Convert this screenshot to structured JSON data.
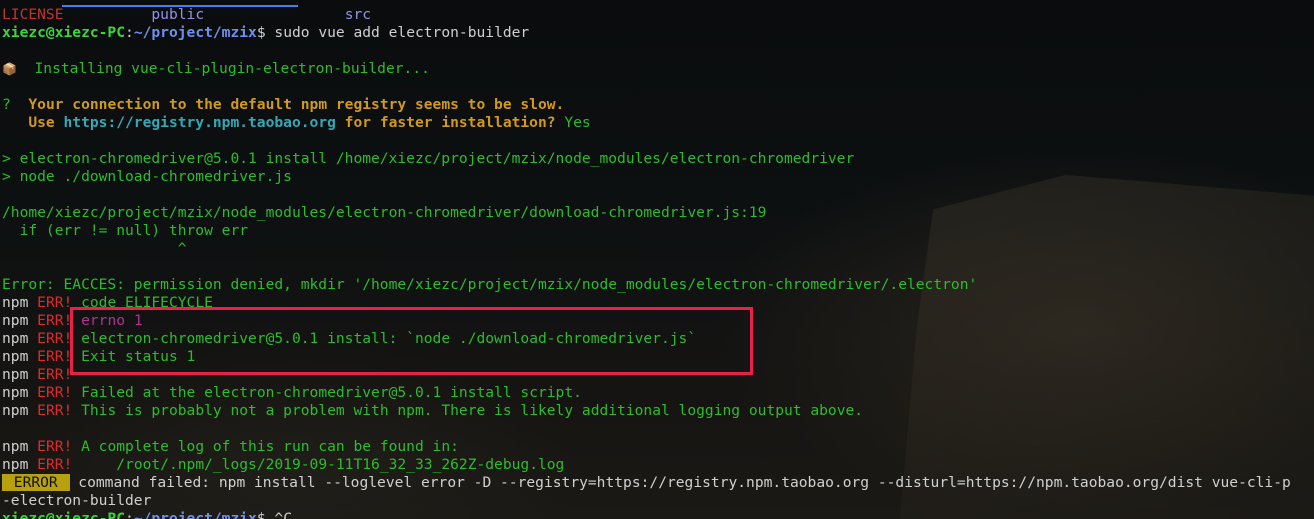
{
  "listing": {
    "license": "LICENSE",
    "public": "public",
    "src": "src"
  },
  "prompt": {
    "user_host": "xiezc@xiezc-PC",
    "colon": ":",
    "path": "~/project/mzix",
    "dollar": "$",
    "command": " sudo vue add electron-builder",
    "final_input": " ^C"
  },
  "installing": {
    "icon": "📦",
    "text": "  Installing vue-cli-plugin-electron-builder..."
  },
  "question": {
    "mark": "?",
    "line1": "  Your connection to the default npm registry seems to be slow.",
    "line2_pre": "   Use ",
    "url": "https://registry.npm.taobao.org",
    "line2_post": " for faster installation?",
    "answer": " Yes"
  },
  "install_lines": [
    "> electron-chromedriver@5.0.1 install /home/xiezc/project/mzix/node_modules/electron-chromedriver",
    "> node ./download-chromedriver.js"
  ],
  "trace": {
    "file": "/home/xiezc/project/mzix/node_modules/electron-chromedriver/download-chromedriver.js:19",
    "code": "  if (err != null) throw err",
    "caret": "                    ^"
  },
  "error_line": "Error: EACCES: permission denied, mkdir '/home/xiezc/project/mzix/node_modules/electron-chromedriver/.electron'",
  "npm_err": {
    "npm": "npm",
    "err": "ERR!",
    "lines": [
      " code ELIFECYCLE",
      " errno 1",
      " electron-chromedriver@5.0.1 install: `node ./download-chromedriver.js`",
      " Exit status 1",
      "",
      " Failed at the electron-chromedriver@5.0.1 install script.",
      " This is probably not a problem with npm. There is likely additional logging output above.",
      " A complete log of this run can be found in:",
      "     /root/.npm/_logs/2019-09-11T16_32_33_262Z-debug.log"
    ]
  },
  "error_badge": " ERROR ",
  "command_failed": " command failed: npm install --loglevel error -D --registry=https://registry.npm.taobao.org --disturl=https://npm.taobao.org/dist vue-cli-p",
  "command_failed_cont": "-electron-builder",
  "colors": {
    "highlight_box": "#e8204b",
    "badge_bg": "#b8a10e"
  }
}
